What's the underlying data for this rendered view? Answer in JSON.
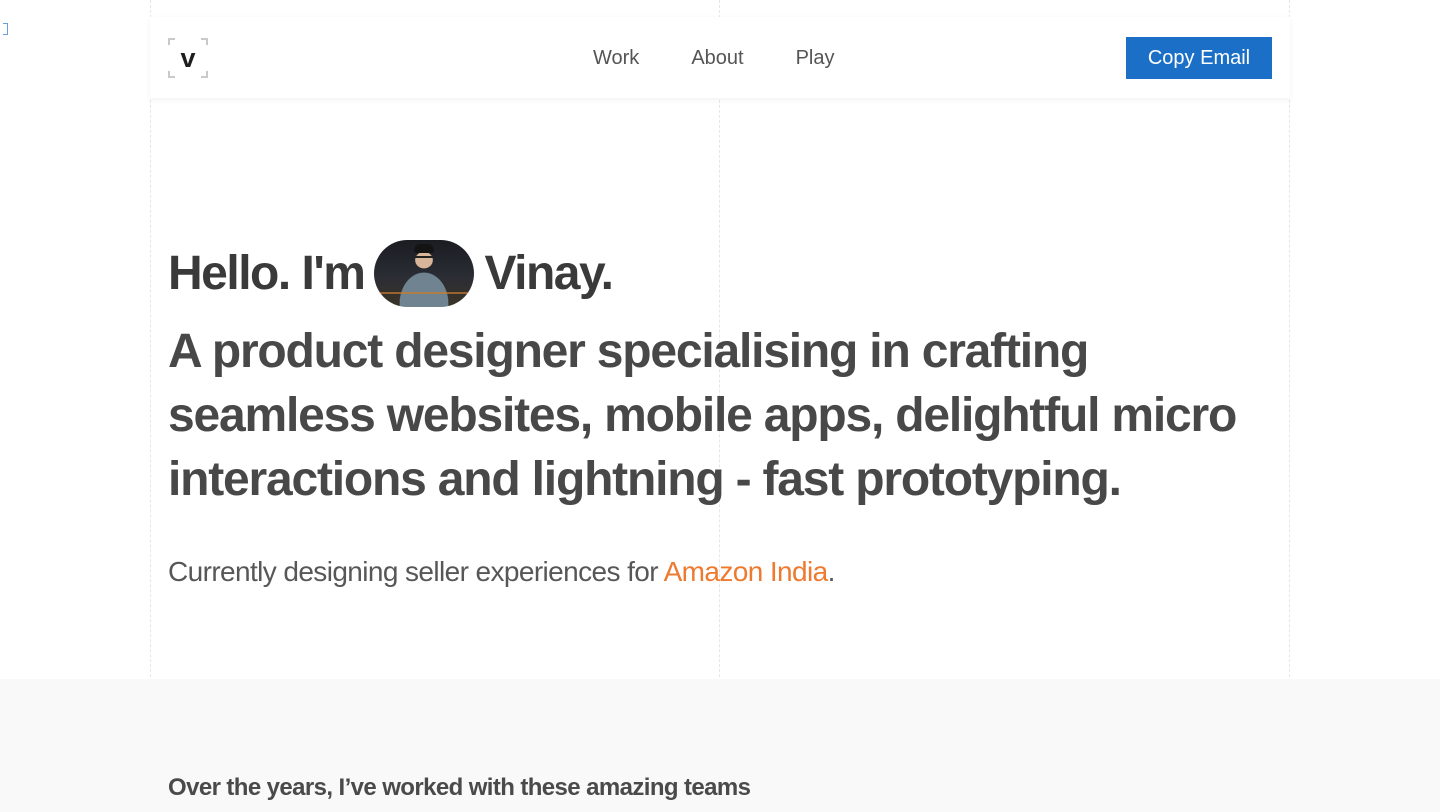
{
  "header": {
    "logo_letter": "v",
    "nav": [
      "Work",
      "About",
      "Play"
    ],
    "cta_label": "Copy Email"
  },
  "hero": {
    "hello_prefix": "Hello. I'm",
    "name": "Vinay.",
    "tagline": "A product designer specialising in crafting seamless websites, mobile apps, delightful micro interactions and lightning - fast prototyping.",
    "current_prefix": "Currently designing seller experiences for ",
    "company": "Amazon India",
    "current_suffix": "."
  },
  "teams": {
    "title": "Over the years, I’ve worked with these amazing teams"
  },
  "colors": {
    "accent_button": "#1b6fc7",
    "company_link": "#ee7a2f"
  }
}
